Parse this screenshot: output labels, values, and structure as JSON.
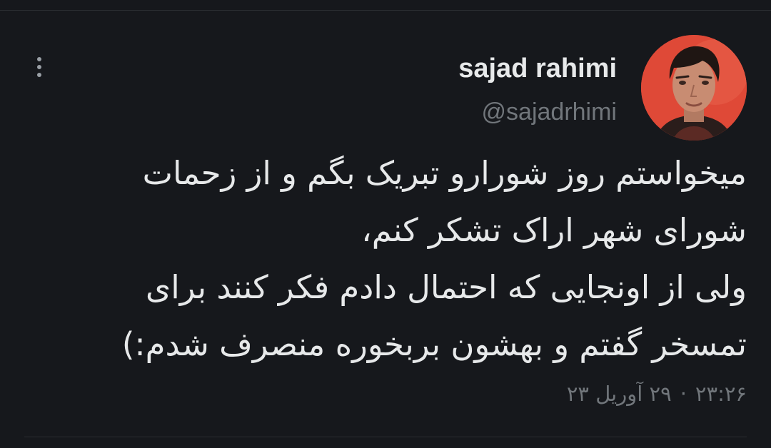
{
  "author": {
    "display_name": "sajad rahimi",
    "handle": "@sajadrhimi",
    "avatar_icon": "profile-photo"
  },
  "tweet": {
    "lines": [
      "میخواستم روز شورارو تبریک بگم و از زحمات",
      "شورای شهر اراک تشکر کنم،",
      "ولی از اونجایی که احتمال دادم فکر کنند برای",
      "تمسخر گفتم و بهشون بربخوره منصرف شدم:)"
    ],
    "time": "۲۳:۲۶",
    "separator": "·",
    "date": "۲۹ آوریل ۲۳"
  },
  "menu": {
    "icon": "more-vertical-icon"
  },
  "colors": {
    "background": "#16181c",
    "text_primary": "#e7e9ea",
    "text_secondary": "#71767b",
    "avatar_bg": "#e14a3a"
  }
}
